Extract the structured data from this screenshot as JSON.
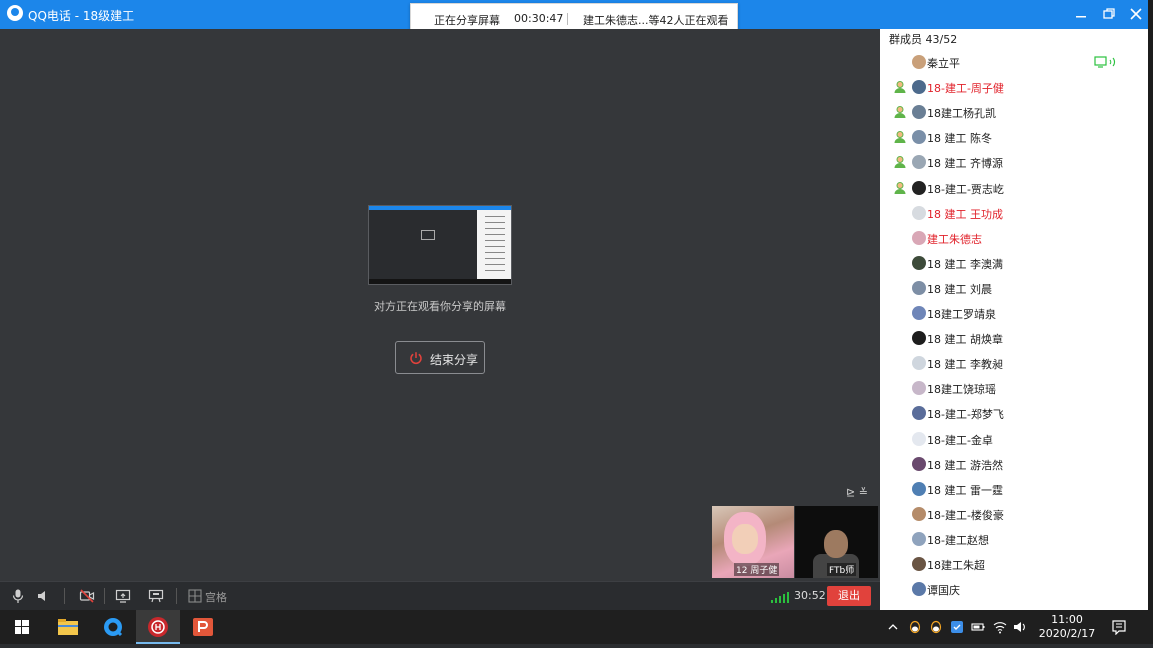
{
  "window": {
    "title": "QQ电话 - 18级建工",
    "minimize_icon": "minimize-icon",
    "restore_icon": "restore-icon",
    "close_icon": "close-icon"
  },
  "banner": {
    "status": "正在分享屏幕",
    "elapsed": "00:30:47",
    "viewers": "建工朱德志...等42人正在观看"
  },
  "main": {
    "hint": "对方正在观看你分享的屏幕",
    "end_share_label": "结束分享",
    "layout_toggle": "⊵ ≚"
  },
  "thumbnails": [
    {
      "name": "12 周子健"
    },
    {
      "name": "FTb师"
    }
  ],
  "toolbar": {
    "grid_label": "宫格",
    "timer": "30:52",
    "exit_label": "退出",
    "icons": [
      "microphone-icon",
      "speaker-icon",
      "camera-off-icon",
      "screen-share-icon",
      "whiteboard-icon",
      "grid-icon"
    ]
  },
  "members": {
    "title": "群成员 43/52",
    "list": [
      {
        "name": "秦立平",
        "red": false,
        "admin": false,
        "avatar": "#c9a07a"
      },
      {
        "name": "18-建工-周子健",
        "red": true,
        "admin": true,
        "avatar": "#4d6a8c"
      },
      {
        "name": "18建工杨孔凯",
        "red": false,
        "admin": true,
        "avatar": "#6a7f95"
      },
      {
        "name": "18 建工 陈冬",
        "red": false,
        "admin": true,
        "avatar": "#7a8fa8"
      },
      {
        "name": "18  建工  齐博源",
        "red": false,
        "admin": true,
        "avatar": "#9aa7b4"
      },
      {
        "name": "18-建工-贾志屹",
        "red": false,
        "admin": true,
        "avatar": "#222222"
      },
      {
        "name": "18  建工   王功成",
        "red": true,
        "admin": false,
        "avatar": "#d7dbe0"
      },
      {
        "name": "建工朱德志",
        "red": true,
        "admin": false,
        "avatar": "#d9a7b6"
      },
      {
        "name": "18 建工 李澳满",
        "red": false,
        "admin": false,
        "avatar": "#3d4b3a"
      },
      {
        "name": "18    建工  刘晨",
        "red": false,
        "admin": false,
        "avatar": "#7d8ea5"
      },
      {
        "name": "18建工罗靖泉",
        "red": false,
        "admin": false,
        "avatar": "#6f86b8"
      },
      {
        "name": "18 建工 胡焕章",
        "red": false,
        "admin": false,
        "avatar": "#1d1d1d"
      },
      {
        "name": "18 建工 李教昶",
        "red": false,
        "admin": false,
        "avatar": "#cfd6de"
      },
      {
        "name": "18建工饶琼瑶",
        "red": false,
        "admin": false,
        "avatar": "#c7b7c9"
      },
      {
        "name": "18-建工-郑梦飞",
        "red": false,
        "admin": false,
        "avatar": "#5a6d9a"
      },
      {
        "name": "18-建工-金卓",
        "red": false,
        "admin": false,
        "avatar": "#e4e8ef"
      },
      {
        "name": "18 建工 游浩然",
        "red": false,
        "admin": false,
        "avatar": "#6a4a6e"
      },
      {
        "name": "18 建工 雷一霆",
        "red": false,
        "admin": false,
        "avatar": "#4f7fb3"
      },
      {
        "name": "18-建工-楼俊豪",
        "red": false,
        "admin": false,
        "avatar": "#b58c6a"
      },
      {
        "name": "18-建工赵想",
        "red": false,
        "admin": false,
        "avatar": "#8fa3bd"
      },
      {
        "name": "18建工朱超",
        "red": false,
        "admin": false,
        "avatar": "#6a5544"
      },
      {
        "name": "谭国庆",
        "red": false,
        "admin": false,
        "avatar": "#5b79a8"
      }
    ]
  },
  "taskbar": {
    "time": "11:00",
    "date": "2020/2/17",
    "apps": [
      "windows-start-icon",
      "file-explorer-icon",
      "qq-browser-icon",
      "huawei-app-icon",
      "powerpoint-icon"
    ]
  },
  "colors": {
    "accent": "#1c86ea",
    "danger": "#e1423c",
    "red_name": "#e1222b"
  }
}
